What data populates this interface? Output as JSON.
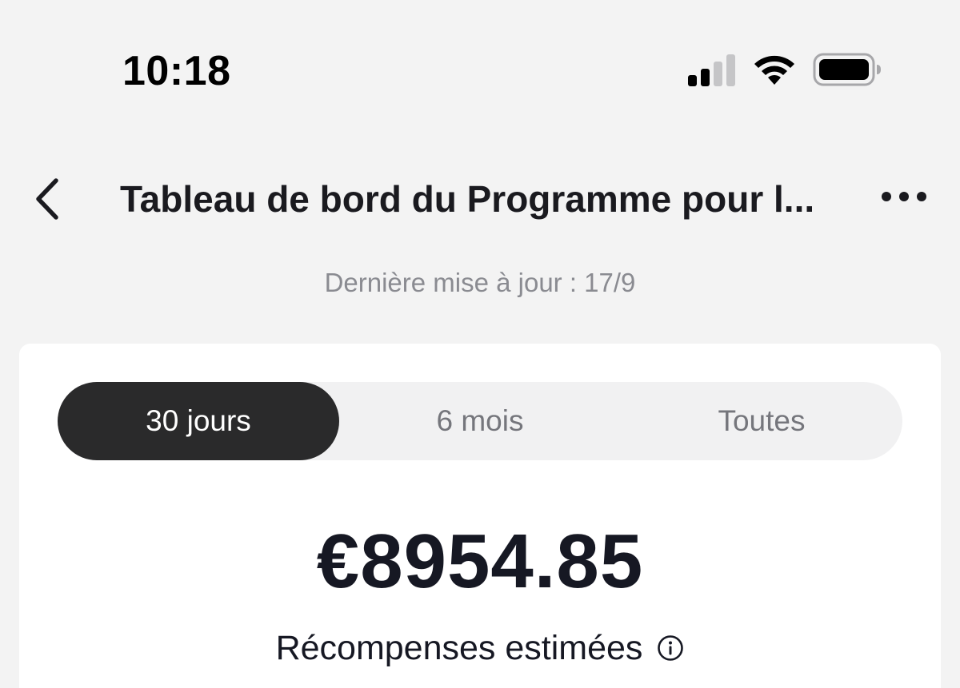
{
  "status_bar": {
    "time": "10:18",
    "signal_icon": "cellular-signal-icon",
    "wifi_icon": "wifi-icon",
    "battery_icon": "battery-icon"
  },
  "nav": {
    "back_icon": "chevron-left-icon",
    "title": "Tableau de bord du Programme pour l...",
    "more_icon": "more-horizontal-icon"
  },
  "last_update": "Dernière mise à jour : 17/9",
  "period_tabs": [
    {
      "label": "30 jours",
      "selected": true
    },
    {
      "label": "6 mois",
      "selected": false
    },
    {
      "label": "Toutes",
      "selected": false
    }
  ],
  "summary": {
    "amount": "€8954.85",
    "label": "Récompenses estimées",
    "info_icon": "info-icon"
  },
  "colors": {
    "background": "#f3f3f3",
    "card": "#ffffff",
    "tab_active_bg": "#2a2a2b",
    "tab_inactive_text": "#75767c",
    "primary_text": "#161823",
    "muted_text": "#8a8b91"
  }
}
